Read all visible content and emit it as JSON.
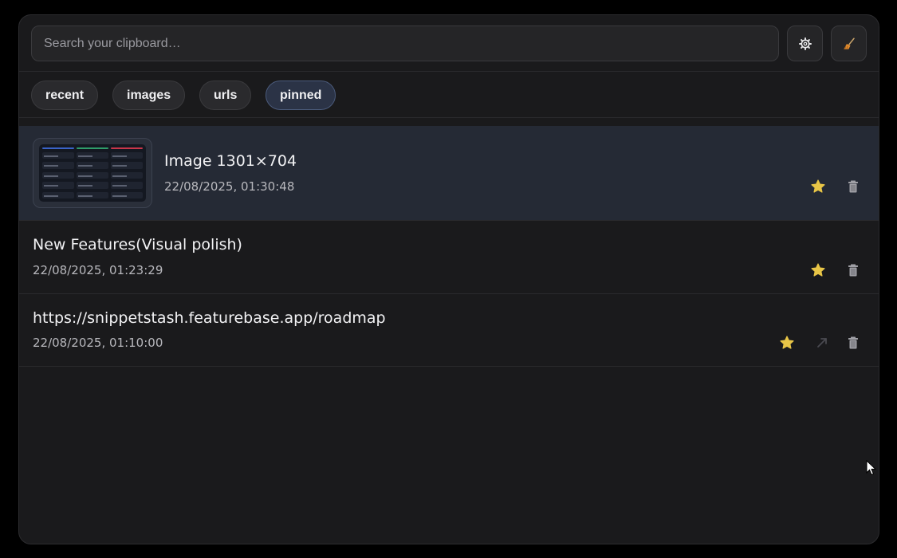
{
  "search": {
    "placeholder": "Search your clipboard…",
    "value": ""
  },
  "toolbar": {
    "settings_icon": "gear-icon",
    "clear_icon": "broom-icon"
  },
  "filters": [
    {
      "label": "recent",
      "active": false
    },
    {
      "label": "images",
      "active": false
    },
    {
      "label": "urls",
      "active": false
    },
    {
      "label": "pinned",
      "active": true
    }
  ],
  "items": [
    {
      "type": "image",
      "title": "Image 1301×704",
      "timestamp": "22/08/2025, 01:30:48",
      "pinned": true,
      "icons": [
        "star-icon",
        "trash-icon"
      ]
    },
    {
      "type": "text",
      "title": "New Features(Visual polish)",
      "timestamp": "22/08/2025, 01:23:29",
      "pinned": true,
      "icons": [
        "star-icon",
        "trash-icon"
      ]
    },
    {
      "type": "url",
      "title": "https://snippetstash.featurebase.app/roadmap",
      "timestamp": "22/08/2025, 01:10:00",
      "pinned": true,
      "icons": [
        "star-icon",
        "open-link-icon",
        "trash-icon"
      ]
    }
  ],
  "colors": {
    "background": "#1a1a1c",
    "highlight": "#252a35",
    "star": "#e8c547",
    "broom": "#e08a2c"
  }
}
